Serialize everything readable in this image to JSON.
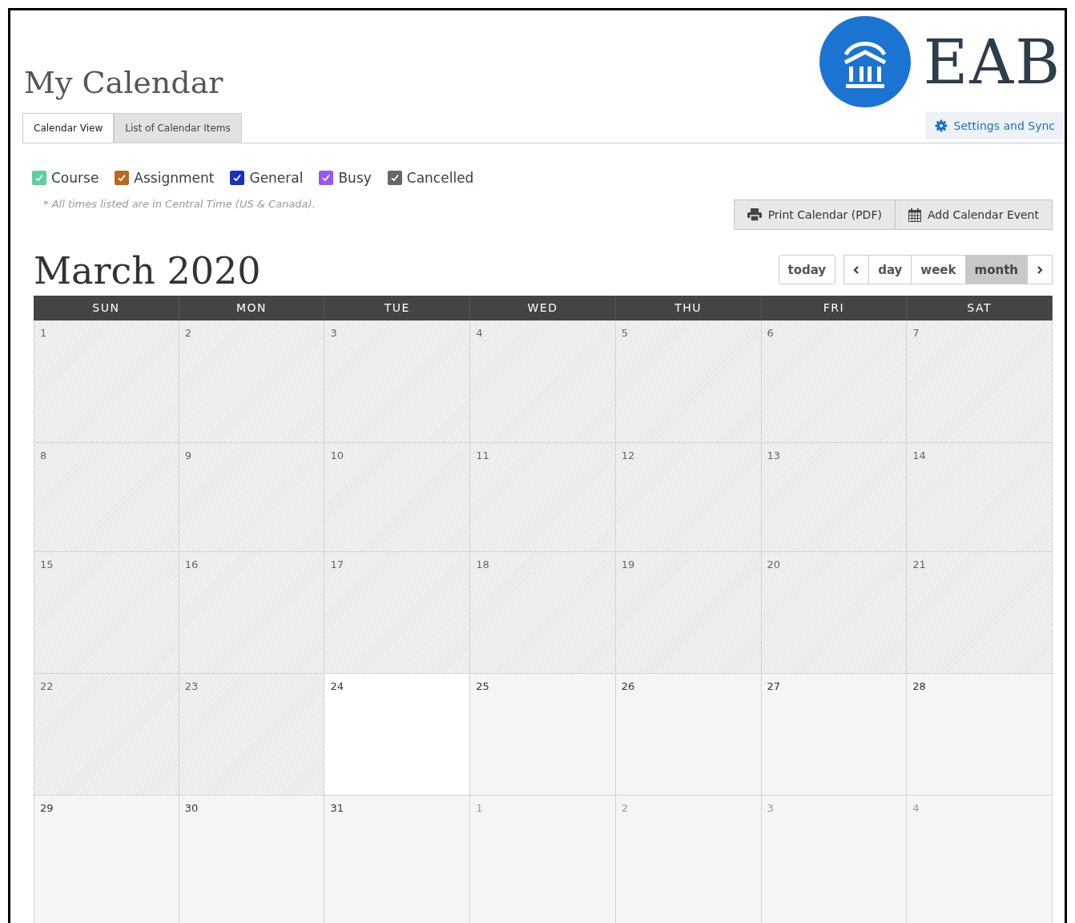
{
  "page": {
    "title": "My Calendar"
  },
  "logo": {
    "text": "EAB"
  },
  "settings_button": {
    "label": "Settings and Sync"
  },
  "tabs": [
    {
      "label": "Calendar View",
      "selected": true
    },
    {
      "label": "List of Calendar Items",
      "selected": false
    }
  ],
  "legend": [
    {
      "label": "Course",
      "checked": true,
      "color": "#5ecf9f"
    },
    {
      "label": "Assignment",
      "checked": true,
      "color": "#b8681f"
    },
    {
      "label": "General",
      "checked": true,
      "color": "#1733b8"
    },
    {
      "label": "Busy",
      "checked": true,
      "color": "#9d55f5"
    },
    {
      "label": "Cancelled",
      "checked": true,
      "color": "#666666"
    }
  ],
  "timezone_note": "* All times listed are in Central Time (US & Canada).",
  "actions": [
    {
      "label": "Print Calendar (PDF)",
      "kind": "print"
    },
    {
      "label": "Add Calendar Event",
      "kind": "add"
    }
  ],
  "calendar": {
    "title": "March 2020",
    "today_button": "today",
    "views": [
      {
        "label": "day",
        "selected": false
      },
      {
        "label": "week",
        "selected": false
      },
      {
        "label": "month",
        "selected": true
      }
    ],
    "weekdays": [
      "SUN",
      "MON",
      "TUE",
      "WED",
      "THU",
      "FRI",
      "SAT"
    ],
    "weeks": [
      [
        {
          "day": "1",
          "kind": "past"
        },
        {
          "day": "2",
          "kind": "past"
        },
        {
          "day": "3",
          "kind": "past"
        },
        {
          "day": "4",
          "kind": "past"
        },
        {
          "day": "5",
          "kind": "past"
        },
        {
          "day": "6",
          "kind": "past"
        },
        {
          "day": "7",
          "kind": "past"
        }
      ],
      [
        {
          "day": "8",
          "kind": "past"
        },
        {
          "day": "9",
          "kind": "past"
        },
        {
          "day": "10",
          "kind": "past"
        },
        {
          "day": "11",
          "kind": "past"
        },
        {
          "day": "12",
          "kind": "past"
        },
        {
          "day": "13",
          "kind": "past"
        },
        {
          "day": "14",
          "kind": "past"
        }
      ],
      [
        {
          "day": "15",
          "kind": "past"
        },
        {
          "day": "16",
          "kind": "past"
        },
        {
          "day": "17",
          "kind": "past"
        },
        {
          "day": "18",
          "kind": "past"
        },
        {
          "day": "19",
          "kind": "past"
        },
        {
          "day": "20",
          "kind": "past"
        },
        {
          "day": "21",
          "kind": "past"
        }
      ],
      [
        {
          "day": "22",
          "kind": "past"
        },
        {
          "day": "23",
          "kind": "past"
        },
        {
          "day": "24",
          "kind": "today"
        },
        {
          "day": "25",
          "kind": "future"
        },
        {
          "day": "26",
          "kind": "future"
        },
        {
          "day": "27",
          "kind": "future"
        },
        {
          "day": "28",
          "kind": "future"
        }
      ],
      [
        {
          "day": "29",
          "kind": "future"
        },
        {
          "day": "30",
          "kind": "future"
        },
        {
          "day": "31",
          "kind": "future"
        },
        {
          "day": "1",
          "kind": "other"
        },
        {
          "day": "2",
          "kind": "other"
        },
        {
          "day": "3",
          "kind": "other"
        },
        {
          "day": "4",
          "kind": "other"
        }
      ]
    ]
  }
}
